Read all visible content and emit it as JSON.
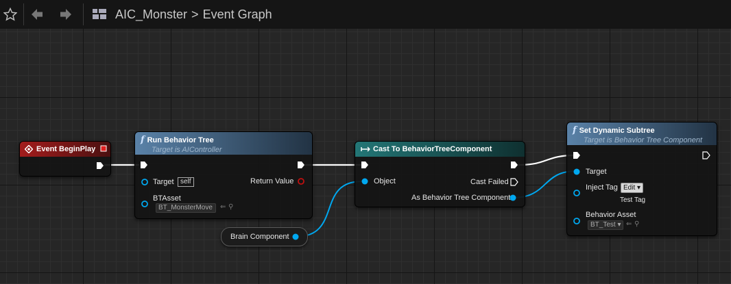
{
  "toolbar": {
    "star_icon": "star-icon",
    "back_icon": "arrow-left-icon",
    "forward_icon": "arrow-right-icon",
    "graph_icon": "blueprint-graph-icon",
    "breadcrumb_asset": "AIC_Monster",
    "breadcrumb_separator": ">",
    "breadcrumb_graph": "Event Graph"
  },
  "nodes": {
    "event_begin_play": {
      "title": "Event BeginPlay"
    },
    "run_behavior_tree": {
      "title": "Run Behavior Tree",
      "subtitle": "Target is AIController",
      "target_label": "Target",
      "target_value": "self",
      "return_label": "Return Value",
      "btasset_label": "BTAsset",
      "btasset_value": "BT_MonsterMove"
    },
    "cast_node": {
      "title": "Cast To BehaviorTreeComponent",
      "object_label": "Object",
      "cast_failed_label": "Cast Failed",
      "as_label": "As Behavior Tree Component"
    },
    "set_dynamic_subtree": {
      "title": "Set Dynamic Subtree",
      "subtitle": "Target is Behavior Tree Component",
      "target_label": "Target",
      "inject_tag_label": "Inject Tag",
      "inject_tag_button": "Edit",
      "inject_tag_value": "Test Tag",
      "behavior_asset_label": "Behavior Asset",
      "behavior_asset_value": "BT_Test"
    },
    "brain_component": {
      "label": "Brain Component"
    }
  },
  "colors": {
    "event_header": "#8a1717",
    "function_header": "#4a6f93",
    "cast_header": "#1e6060",
    "object_pin": "#00a8f0",
    "return_pin": "#a01010",
    "exec_wire": "#ffffff"
  }
}
